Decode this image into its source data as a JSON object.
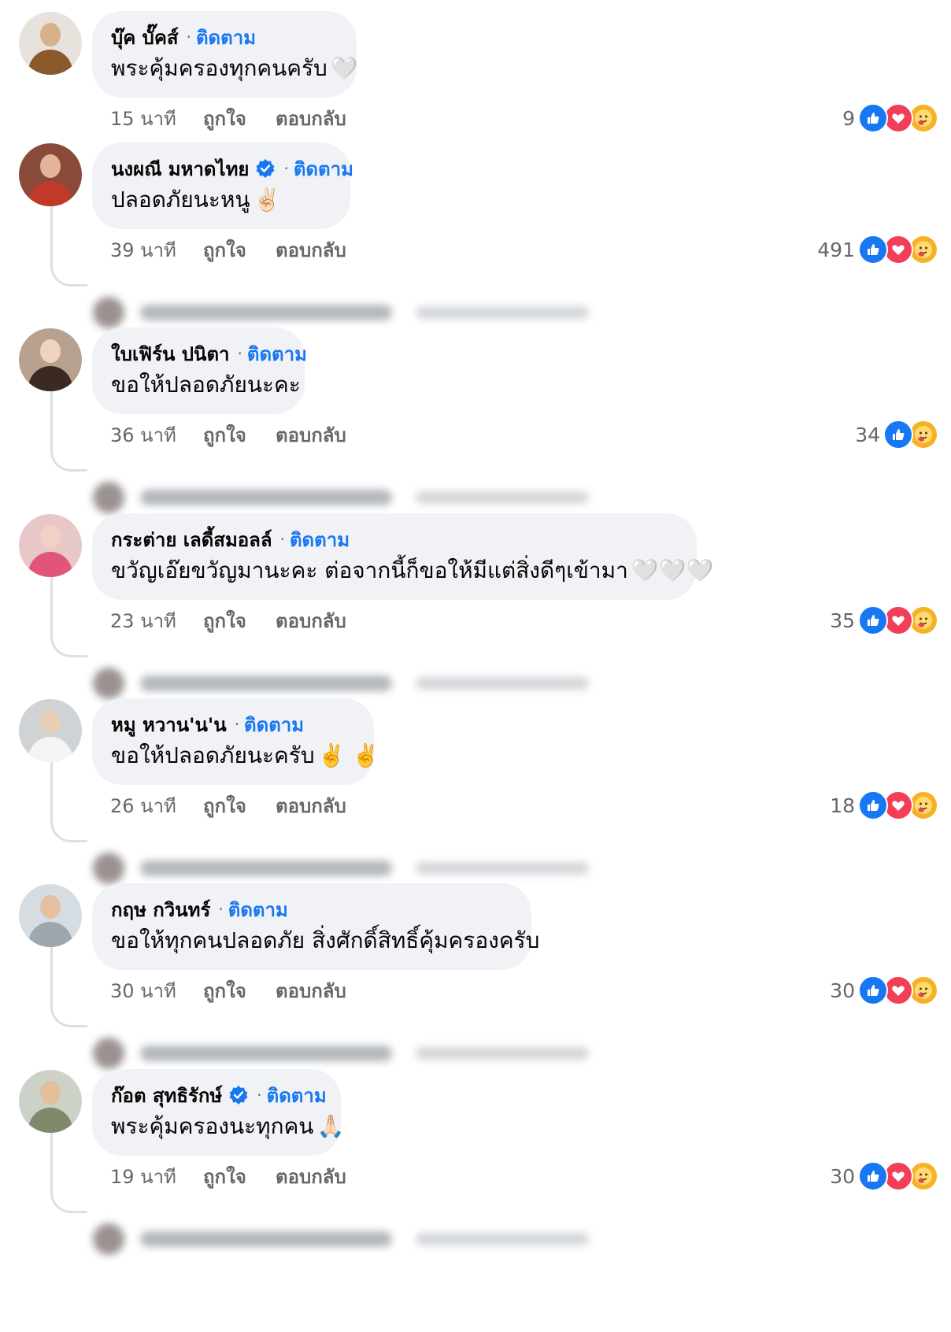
{
  "follow_label": "ติดตาม",
  "like_label": "ถูกใจ",
  "reply_label": "ตอบกลับ",
  "colors": {
    "accent": "#1877f2",
    "bubble": "#f0f2f5",
    "muted": "#65676b",
    "love": "#f33e58",
    "care": "#f7b125"
  },
  "comments": [
    {
      "name": "บุ๊ค บั๊คส์",
      "verified": false,
      "text": "พระคุ้มครองทุกคนครับ",
      "emoji": "🤍",
      "time": "15 นาที",
      "count": "9",
      "reactions": [
        "like-icon",
        "love-icon",
        "care-icon"
      ],
      "has_reply": false,
      "avatar_bg": "#e7e3dc",
      "avatar_head": "#d9b08c",
      "avatar_body": "#8a5a2b"
    },
    {
      "name": "นงผณี มหาดไทย",
      "verified": true,
      "text": "ปลอดภัยนะหนู",
      "emoji": "✌🏻",
      "time": "39 นาที",
      "count": "491",
      "reactions": [
        "like-icon",
        "love-icon",
        "care-icon"
      ],
      "has_reply": true,
      "avatar_bg": "#8a4a3a",
      "avatar_head": "#e2b49a",
      "avatar_body": "#c0392b"
    },
    {
      "name": "ใบเฟิร์น ปนิตา",
      "verified": false,
      "text": "ขอให้ปลอดภัยนะคะ",
      "emoji": "",
      "time": "36 นาที",
      "count": "34",
      "reactions": [
        "like-icon",
        "care-icon"
      ],
      "has_reply": true,
      "avatar_bg": "#b9a18f",
      "avatar_head": "#f0d2bf",
      "avatar_body": "#3a2a22"
    },
    {
      "name": "กระต่าย เลดี้สมอลล์",
      "verified": false,
      "text": "ขวัญเอ๊ยขวัญมานะคะ ต่อจากนี้ก็ขอให้มีแต่สิ่งดีๆเข้ามา",
      "emoji": "🤍🤍🤍",
      "time": "23 นาที",
      "count": "35",
      "reactions": [
        "like-icon",
        "love-icon",
        "care-icon"
      ],
      "has_reply": true,
      "avatar_bg": "#e8c7c9",
      "avatar_head": "#f2d0c4",
      "avatar_body": "#e2557a"
    },
    {
      "name": "หมู หวาน'น'น",
      "verified": false,
      "text": "ขอให้ปลอดภัยนะครับ",
      "emoji": "✌️ ✌️",
      "time": "26 นาที",
      "count": "18",
      "reactions": [
        "like-icon",
        "love-icon",
        "care-icon"
      ],
      "has_reply": true,
      "avatar_bg": "#cfd3d6",
      "avatar_head": "#e8cfb5",
      "avatar_body": "#f4f4f4"
    },
    {
      "name": "กฤษ กวินทร์",
      "verified": false,
      "text": "ขอให้ทุกคนปลอดภัย สิ่งศักดิ์สิทธิ์คุ้มครองครับ",
      "emoji": "",
      "time": "30 นาที",
      "count": "30",
      "reactions": [
        "like-icon",
        "love-icon",
        "care-icon"
      ],
      "has_reply": true,
      "avatar_bg": "#d5dde3",
      "avatar_head": "#e5c0a0",
      "avatar_body": "#9ea7ad"
    },
    {
      "name": "ก๊อต สุทธิรักษ์",
      "verified": true,
      "text": "พระคุ้มครองนะทุกคน",
      "emoji": "🙏🏻",
      "time": "19 นาที",
      "count": "30",
      "reactions": [
        "like-icon",
        "love-icon",
        "care-icon"
      ],
      "has_reply": true,
      "avatar_bg": "#ccd2c8",
      "avatar_head": "#e3bf9c",
      "avatar_body": "#7e8a6a"
    }
  ]
}
